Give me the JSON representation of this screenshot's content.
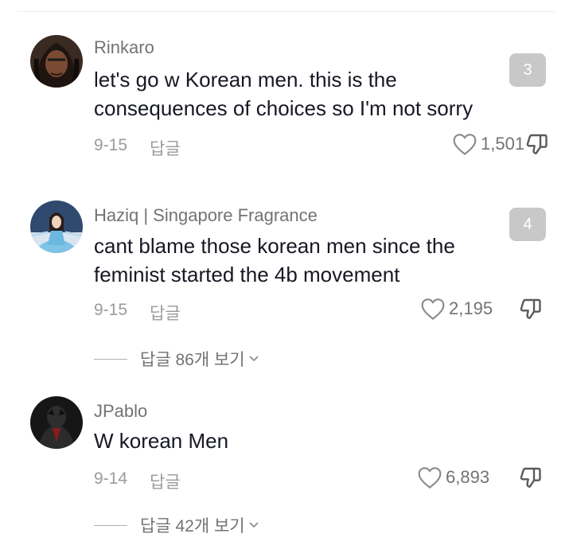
{
  "comments": [
    {
      "username": "Rinkaro",
      "line1": "let's go w Korean men. this is the",
      "line2": "consequences of choices so I'm not sorry",
      "date": "9-15",
      "reply_label": "답글",
      "likes": "1,501",
      "badge": "3"
    },
    {
      "username": "Haziq | Singapore Fragrance",
      "line1": "cant blame those korean men since the",
      "line2": "feminist started the 4b movement",
      "date": "9-15",
      "reply_label": "답글",
      "likes": "2,195",
      "badge": "4",
      "view_replies": "답글 86개 보기"
    },
    {
      "username": "JPablo",
      "line1": "W korean Men",
      "date": "9-14",
      "reply_label": "답글",
      "likes": "6,893",
      "view_replies": "답글 42개 보기"
    }
  ],
  "icons": {
    "like": "heart-outline-icon",
    "dislike": "thumbs-down-icon",
    "expand": "chevron-down-icon"
  }
}
